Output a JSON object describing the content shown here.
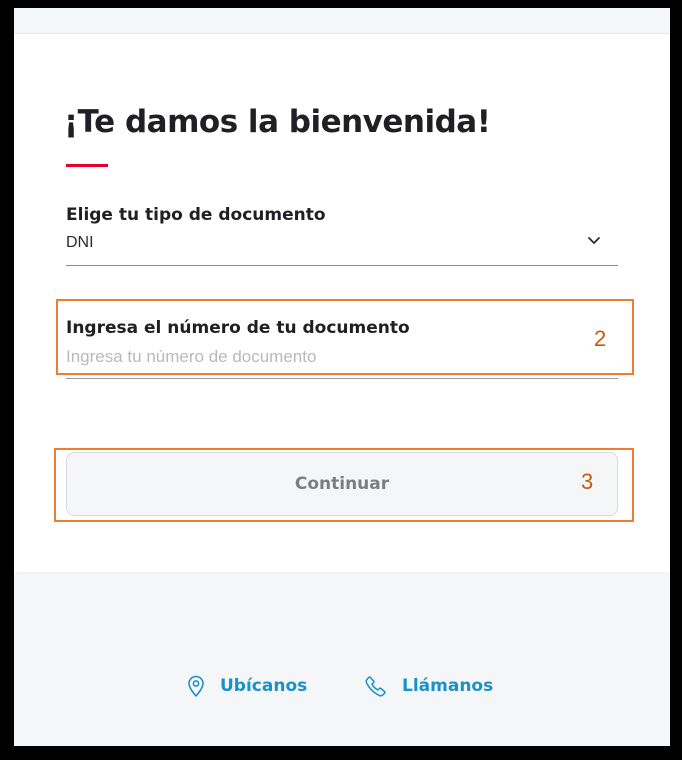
{
  "login_form": {
    "title": "¡Te damos la bienvenida!",
    "accent_color": "#e4002b",
    "document_type": {
      "label": "Elige tu tipo de documento",
      "selected_value": "DNI",
      "icon": "chevron-down-icon"
    },
    "document_number": {
      "label": "Ingresa el número de tu documento",
      "value": "",
      "placeholder": "Ingresa tu número de documento"
    },
    "continue_button": {
      "label": "Continuar"
    }
  },
  "annotations": {
    "highlight_color": "#ed7d31",
    "field_marker": "2",
    "button_marker": "3"
  },
  "footer": {
    "link_color": "#1a91c7",
    "links": [
      {
        "label": "Ubícanos",
        "icon": "location-pin-icon"
      },
      {
        "label": "Llámanos",
        "icon": "phone-icon"
      }
    ]
  }
}
